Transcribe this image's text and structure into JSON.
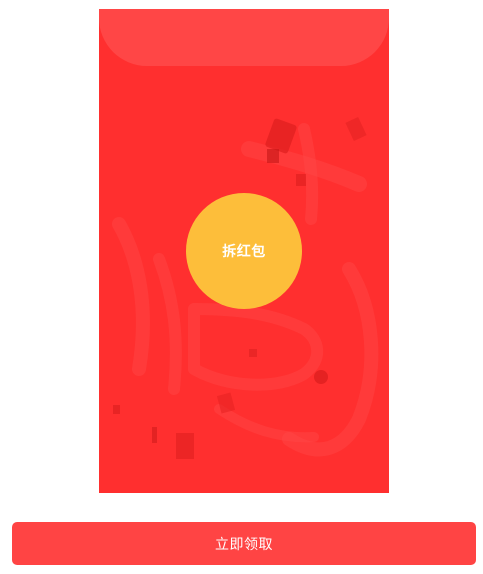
{
  "envelope": {
    "open_label": "拆红包",
    "background_color": "#ff2f2f",
    "flap_color": "#ff4646",
    "button_color": "#fdbe3a"
  },
  "footer": {
    "claim_label": "立即领取",
    "button_color": "#ff4444"
  }
}
